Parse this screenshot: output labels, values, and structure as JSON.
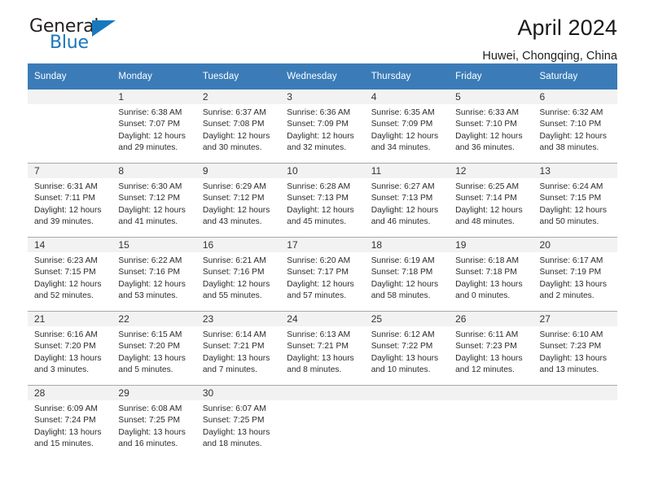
{
  "brand": {
    "logo_text_primary": "General",
    "logo_text_secondary": "Blue",
    "logo_icon": "triangle-flag-icon",
    "accent_color": "#1878be"
  },
  "header": {
    "title": "April 2024",
    "subtitle": "Huwei, Chongqing, China"
  },
  "calendar": {
    "header_bg_color": "#3B7CB8",
    "daynum_band_color": "#F2F2F2",
    "weekday_headers": [
      "Sunday",
      "Monday",
      "Tuesday",
      "Wednesday",
      "Thursday",
      "Friday",
      "Saturday"
    ],
    "weeks": [
      [
        {
          "day": "",
          "lines": []
        },
        {
          "day": "1",
          "lines": [
            "Sunrise: 6:38 AM",
            "Sunset: 7:07 PM",
            "Daylight: 12 hours",
            "and 29 minutes."
          ]
        },
        {
          "day": "2",
          "lines": [
            "Sunrise: 6:37 AM",
            "Sunset: 7:08 PM",
            "Daylight: 12 hours",
            "and 30 minutes."
          ]
        },
        {
          "day": "3",
          "lines": [
            "Sunrise: 6:36 AM",
            "Sunset: 7:09 PM",
            "Daylight: 12 hours",
            "and 32 minutes."
          ]
        },
        {
          "day": "4",
          "lines": [
            "Sunrise: 6:35 AM",
            "Sunset: 7:09 PM",
            "Daylight: 12 hours",
            "and 34 minutes."
          ]
        },
        {
          "day": "5",
          "lines": [
            "Sunrise: 6:33 AM",
            "Sunset: 7:10 PM",
            "Daylight: 12 hours",
            "and 36 minutes."
          ]
        },
        {
          "day": "6",
          "lines": [
            "Sunrise: 6:32 AM",
            "Sunset: 7:10 PM",
            "Daylight: 12 hours",
            "and 38 minutes."
          ]
        }
      ],
      [
        {
          "day": "7",
          "lines": [
            "Sunrise: 6:31 AM",
            "Sunset: 7:11 PM",
            "Daylight: 12 hours",
            "and 39 minutes."
          ]
        },
        {
          "day": "8",
          "lines": [
            "Sunrise: 6:30 AM",
            "Sunset: 7:12 PM",
            "Daylight: 12 hours",
            "and 41 minutes."
          ]
        },
        {
          "day": "9",
          "lines": [
            "Sunrise: 6:29 AM",
            "Sunset: 7:12 PM",
            "Daylight: 12 hours",
            "and 43 minutes."
          ]
        },
        {
          "day": "10",
          "lines": [
            "Sunrise: 6:28 AM",
            "Sunset: 7:13 PM",
            "Daylight: 12 hours",
            "and 45 minutes."
          ]
        },
        {
          "day": "11",
          "lines": [
            "Sunrise: 6:27 AM",
            "Sunset: 7:13 PM",
            "Daylight: 12 hours",
            "and 46 minutes."
          ]
        },
        {
          "day": "12",
          "lines": [
            "Sunrise: 6:25 AM",
            "Sunset: 7:14 PM",
            "Daylight: 12 hours",
            "and 48 minutes."
          ]
        },
        {
          "day": "13",
          "lines": [
            "Sunrise: 6:24 AM",
            "Sunset: 7:15 PM",
            "Daylight: 12 hours",
            "and 50 minutes."
          ]
        }
      ],
      [
        {
          "day": "14",
          "lines": [
            "Sunrise: 6:23 AM",
            "Sunset: 7:15 PM",
            "Daylight: 12 hours",
            "and 52 minutes."
          ]
        },
        {
          "day": "15",
          "lines": [
            "Sunrise: 6:22 AM",
            "Sunset: 7:16 PM",
            "Daylight: 12 hours",
            "and 53 minutes."
          ]
        },
        {
          "day": "16",
          "lines": [
            "Sunrise: 6:21 AM",
            "Sunset: 7:16 PM",
            "Daylight: 12 hours",
            "and 55 minutes."
          ]
        },
        {
          "day": "17",
          "lines": [
            "Sunrise: 6:20 AM",
            "Sunset: 7:17 PM",
            "Daylight: 12 hours",
            "and 57 minutes."
          ]
        },
        {
          "day": "18",
          "lines": [
            "Sunrise: 6:19 AM",
            "Sunset: 7:18 PM",
            "Daylight: 12 hours",
            "and 58 minutes."
          ]
        },
        {
          "day": "19",
          "lines": [
            "Sunrise: 6:18 AM",
            "Sunset: 7:18 PM",
            "Daylight: 13 hours",
            "and 0 minutes."
          ]
        },
        {
          "day": "20",
          "lines": [
            "Sunrise: 6:17 AM",
            "Sunset: 7:19 PM",
            "Daylight: 13 hours",
            "and 2 minutes."
          ]
        }
      ],
      [
        {
          "day": "21",
          "lines": [
            "Sunrise: 6:16 AM",
            "Sunset: 7:20 PM",
            "Daylight: 13 hours",
            "and 3 minutes."
          ]
        },
        {
          "day": "22",
          "lines": [
            "Sunrise: 6:15 AM",
            "Sunset: 7:20 PM",
            "Daylight: 13 hours",
            "and 5 minutes."
          ]
        },
        {
          "day": "23",
          "lines": [
            "Sunrise: 6:14 AM",
            "Sunset: 7:21 PM",
            "Daylight: 13 hours",
            "and 7 minutes."
          ]
        },
        {
          "day": "24",
          "lines": [
            "Sunrise: 6:13 AM",
            "Sunset: 7:21 PM",
            "Daylight: 13 hours",
            "and 8 minutes."
          ]
        },
        {
          "day": "25",
          "lines": [
            "Sunrise: 6:12 AM",
            "Sunset: 7:22 PM",
            "Daylight: 13 hours",
            "and 10 minutes."
          ]
        },
        {
          "day": "26",
          "lines": [
            "Sunrise: 6:11 AM",
            "Sunset: 7:23 PM",
            "Daylight: 13 hours",
            "and 12 minutes."
          ]
        },
        {
          "day": "27",
          "lines": [
            "Sunrise: 6:10 AM",
            "Sunset: 7:23 PM",
            "Daylight: 13 hours",
            "and 13 minutes."
          ]
        }
      ],
      [
        {
          "day": "28",
          "lines": [
            "Sunrise: 6:09 AM",
            "Sunset: 7:24 PM",
            "Daylight: 13 hours",
            "and 15 minutes."
          ]
        },
        {
          "day": "29",
          "lines": [
            "Sunrise: 6:08 AM",
            "Sunset: 7:25 PM",
            "Daylight: 13 hours",
            "and 16 minutes."
          ]
        },
        {
          "day": "30",
          "lines": [
            "Sunrise: 6:07 AM",
            "Sunset: 7:25 PM",
            "Daylight: 13 hours",
            "and 18 minutes."
          ]
        },
        {
          "day": "",
          "lines": []
        },
        {
          "day": "",
          "lines": []
        },
        {
          "day": "",
          "lines": []
        },
        {
          "day": "",
          "lines": []
        }
      ]
    ]
  }
}
